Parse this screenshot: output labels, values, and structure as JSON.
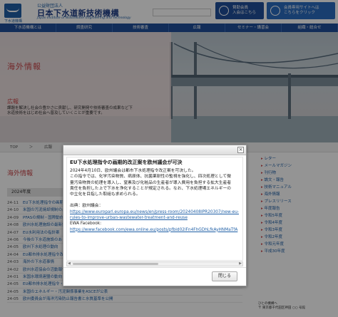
{
  "header": {
    "logo_sub": "下水道機構",
    "org_label": "公益財団法人",
    "org_name": "日本下水道新技術機構",
    "org_en": "Japan Institute of Wastewater Engineering and Technology",
    "btn_member": [
      "賛助会員",
      "入会はこちら"
    ],
    "btn_member_site": [
      "会員専用サイトへは",
      "こちらをクリック"
    ]
  },
  "nav": [
    "下水道機構とは",
    "調査研究",
    "技術審査",
    "広報",
    "セミナー・講習会",
    "組織・総合せ"
  ],
  "hero": {
    "title": "海外情報",
    "section": "広報",
    "desc": "課題を解決し社会の豊かさに貢献し、研究開発や技術審査の成果など下水道技術をはじめ社会へ普及していくことが重要です。"
  },
  "breadcrumb": [
    "TOP",
    "＞",
    "広報",
    "＞",
    "海外"
  ],
  "main": {
    "title": "海外情報",
    "year": "2024年度",
    "rows": [
      {
        "d": "24-11",
        "t": "EU下水処理指令の画期的改正案を欧州議会が可決"
      },
      {
        "d": "24-10",
        "t": "米国の汚泥焼却規制の最新動向"
      },
      {
        "d": "24-09",
        "t": "PFASの規制・国際動向"
      },
      {
        "d": "24-08",
        "t": "欧州水処理施設の最新動向"
      },
      {
        "d": "24-07",
        "t": "EU水利用法の指針案"
      },
      {
        "d": "24-06",
        "t": "今後の下水道施設のあり方"
      },
      {
        "d": "24-05",
        "t": "欧州下水処理の動向"
      },
      {
        "d": "24-04",
        "t": "EU都市排水処理指令改正"
      },
      {
        "d": "24-03",
        "t": "海外の下水道事情"
      },
      {
        "d": "24-02",
        "t": "欧州水道協会の活動報告"
      },
      {
        "d": "24-01",
        "t": "米国水環境連盟の動向"
      },
      {
        "d": "24-05",
        "t": "EU都市排水処理指令・消毒基準の策定動向が公表、動向"
      },
      {
        "d": "24-05",
        "t": "米国のエネルギー・汚泥関係事業をASCEが公表"
      },
      {
        "d": "24-05",
        "t": "欧州委員会が海洋汚染防止報告書と水質基準を公開"
      }
    ]
  },
  "sidebar": {
    "items": [
      "レター",
      "メールマガジン",
      "刊行物",
      "論文・報告",
      "技術マニュアル",
      "海外情報",
      "プレスリリース",
      "年度報告",
      "令和5年度",
      "令和4年度",
      "令和3年度",
      "令和2年度",
      "令和元年度",
      "平成30年度"
    ],
    "footer": [
      "ひとの機構へ",
      "〒 東京都千代田区神田 ○○ 号館"
    ]
  },
  "modal": {
    "title": "EU下水処理指令の画期的改正案を欧州議会が可決",
    "lines": [
      "2024年4月10日、欧州議会は都市下水処理指令改正案を可決した。",
      "この指令では、化学汚染物質、病原体、抗菌薬耐性の監視を強化し、四次処理として微",
      "量汚染物質の処理を導入し、窒素及び化粧品の生産者が導入費用を負担する拡大生産者",
      "責任を負担した上で下水を浄化することが規定される。なお、下水処理場エネルギーの",
      "中立化を目指した取組も求められる。"
    ],
    "source_label": "出典：欧州議会：",
    "source_url": "https://www.europarl.europa.eu/news/en/press-room/20240408IPR20307/new-eu-rules-to-improve-urban-wastewater-treatment-and-reuse",
    "ewa_label": "EWA Facebook:",
    "ewa_url": "https://www.facebook.com/ewa.online.eu/posts/pfbid02iFn4FhGDhLfkAyHNMaTfA",
    "close_label": "閉じる"
  }
}
